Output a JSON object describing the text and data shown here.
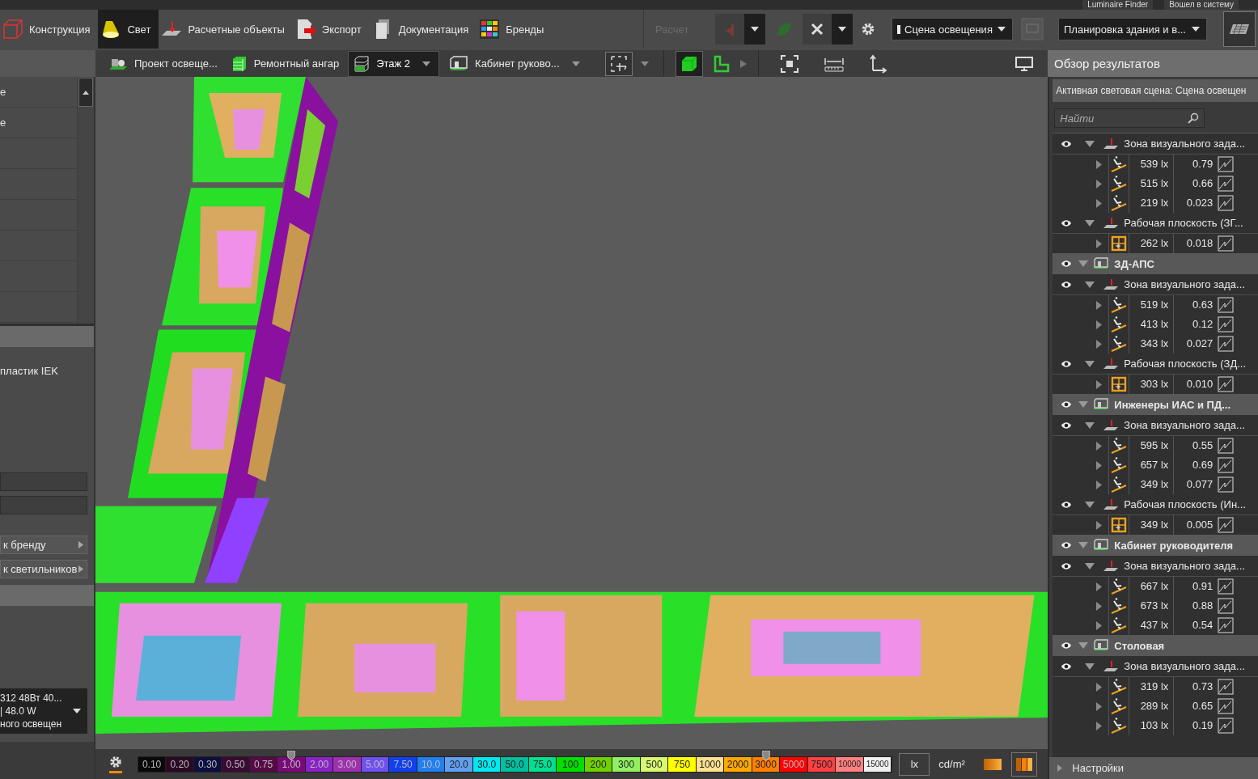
{
  "top_strip": {
    "items": [
      "Luminaire Finder",
      "Вошел в систему"
    ]
  },
  "menu": {
    "tabs": [
      {
        "label": "Конструкция",
        "kind": "construction",
        "selected": false
      },
      {
        "label": "Свет",
        "kind": "light",
        "selected": true
      },
      {
        "label": "Расчетные объекты",
        "kind": "calc",
        "selected": false
      },
      {
        "label": "Экспорт",
        "kind": "export",
        "selected": false
      },
      {
        "label": "Документация",
        "kind": "docs",
        "selected": false
      },
      {
        "label": "Бренды",
        "kind": "brands",
        "selected": false
      }
    ],
    "calc": {
      "label": "Расчет",
      "disabled": true
    },
    "scene": {
      "value": "Сцена освещения"
    },
    "view_mode": {
      "value": "Планировка здания и в..."
    }
  },
  "breadcrumb": [
    {
      "label": "Проект освеще...",
      "kind": "project",
      "selected": false,
      "dropdown": false
    },
    {
      "label": "Ремонтный ангар",
      "kind": "building",
      "selected": false,
      "dropdown": false
    },
    {
      "label": "Этаж 2",
      "kind": "floor",
      "selected": true,
      "dropdown": true
    },
    {
      "label": "Кабинет руково...",
      "kind": "room",
      "selected": false,
      "dropdown": true
    }
  ],
  "view_buttons": [
    {
      "kind": "cube",
      "selected": true
    },
    {
      "kind": "plan",
      "selected": false
    }
  ],
  "left_panel": {
    "list": [
      "е",
      "е"
    ],
    "luminaire_text": "пластик IEK",
    "buttons": [
      "к бренду",
      "к светильников"
    ],
    "luminaire_select": [
      "312 48Вт 40...",
      "| 48.0 W",
      "ного освещен"
    ]
  },
  "legend": {
    "stops": [
      {
        "label": "0.10",
        "color": "#0a0a0a",
        "marked": false
      },
      {
        "label": "0.20",
        "color": "#2a0a22",
        "marked": false
      },
      {
        "label": "0.30",
        "color": "#0e0e40",
        "marked": false
      },
      {
        "label": "0.50",
        "color": "#3a0a34",
        "marked": false
      },
      {
        "label": "0.75",
        "color": "#560a46",
        "marked": false
      },
      {
        "label": "1.00",
        "color": "#7a0a7a",
        "marked": true
      },
      {
        "label": "2.00",
        "color": "#8a22c8",
        "marked": false
      },
      {
        "label": "3.00",
        "color": "#a030b0",
        "marked": false
      },
      {
        "label": "5.00",
        "color": "#7050f0",
        "marked": false
      },
      {
        "label": "7.50",
        "color": "#1040f0",
        "marked": false
      },
      {
        "label": "10.0",
        "color": "#2080f0",
        "marked": false
      },
      {
        "label": "20.0",
        "color": "#60a0f0",
        "marked": false
      },
      {
        "label": "30.0",
        "color": "#00e8f0",
        "marked": false
      },
      {
        "label": "50.0",
        "color": "#00c0a0",
        "marked": false
      },
      {
        "label": "75.0",
        "color": "#00e090",
        "marked": false
      },
      {
        "label": "100",
        "color": "#00e000",
        "marked": false
      },
      {
        "label": "200",
        "color": "#70d000",
        "marked": false
      },
      {
        "label": "300",
        "color": "#90f060",
        "marked": false
      },
      {
        "label": "500",
        "color": "#d8f870",
        "marked": false
      },
      {
        "label": "750",
        "color": "#ffff00",
        "marked": false
      },
      {
        "label": "1000",
        "color": "#ffe090",
        "marked": false
      },
      {
        "label": "2000",
        "color": "#ffa800",
        "marked": false
      },
      {
        "label": "3000",
        "color": "#ff8000",
        "marked": true
      },
      {
        "label": "5000",
        "color": "#ff0000",
        "marked": false
      },
      {
        "label": "7500",
        "color": "#ff4040",
        "marked": false
      },
      {
        "label": "10000",
        "color": "#ff8080",
        "marked": false
      },
      {
        "label": "15000",
        "color": "#f0f0f0",
        "marked": false
      }
    ],
    "units": [
      {
        "label": "lx",
        "selected": true
      },
      {
        "label": "cd/m²",
        "selected": false
      }
    ]
  },
  "results": {
    "title": "Обзор результатов",
    "active_scene": "Активная световая сцена: Сцена освещен",
    "search": {
      "placeholder": "Найти"
    },
    "tree": [
      {
        "kind": "zone",
        "label": "Зона визуального зада...",
        "expanded": true,
        "children": [
          {
            "kind": "point_result",
            "value": "539 lx",
            "ratio": "0.79",
            "expanded": false
          },
          {
            "kind": "point_result",
            "value": "515 lx",
            "ratio": "0.66",
            "expanded": false
          },
          {
            "kind": "point_result",
            "value": "219 lx",
            "ratio": "0.023",
            "expanded": false
          }
        ]
      },
      {
        "kind": "zone",
        "label": "Рабочая плоскость (ЗГ...",
        "expanded": true,
        "children": [
          {
            "kind": "grid_result",
            "value": "262 lx",
            "ratio": "0.018",
            "expanded": false
          }
        ]
      },
      {
        "kind": "room",
        "label": "ЗД-АПС",
        "expanded": true,
        "children": [
          {
            "kind": "zone",
            "label": "Зона визуального зада...",
            "expanded": true,
            "children": [
              {
                "kind": "point_result",
                "value": "519 lx",
                "ratio": "0.63",
                "expanded": false
              },
              {
                "kind": "point_result",
                "value": "413 lx",
                "ratio": "0.12",
                "expanded": false
              },
              {
                "kind": "point_result",
                "value": "343 lx",
                "ratio": "0.027",
                "expanded": false
              }
            ]
          },
          {
            "kind": "zone",
            "label": "Рабочая плоскость (ЗД...",
            "expanded": true,
            "children": [
              {
                "kind": "grid_result",
                "value": "303 lx",
                "ratio": "0.010",
                "expanded": false
              }
            ]
          }
        ]
      },
      {
        "kind": "room",
        "label": "Инженеры ИАС и ПД...",
        "expanded": true,
        "children": [
          {
            "kind": "zone",
            "label": "Зона визуального зада...",
            "expanded": true,
            "children": [
              {
                "kind": "point_result",
                "value": "595 lx",
                "ratio": "0.55",
                "expanded": false
              },
              {
                "kind": "point_result",
                "value": "657 lx",
                "ratio": "0.69",
                "expanded": false
              },
              {
                "kind": "point_result",
                "value": "349 lx",
                "ratio": "0.077",
                "expanded": false
              }
            ]
          },
          {
            "kind": "zone",
            "label": "Рабочая плоскость (Ин...",
            "expanded": true,
            "children": [
              {
                "kind": "grid_result",
                "value": "349 lx",
                "ratio": "0.005",
                "expanded": false
              }
            ]
          }
        ]
      },
      {
        "kind": "room",
        "label": "Кабинет руководителя",
        "expanded": true,
        "children": [
          {
            "kind": "zone",
            "label": "Зона визуального зада...",
            "expanded": true,
            "children": [
              {
                "kind": "point_result",
                "value": "667 lx",
                "ratio": "0.91",
                "expanded": false
              },
              {
                "kind": "point_result",
                "value": "673 lx",
                "ratio": "0.88",
                "expanded": false
              },
              {
                "kind": "point_result",
                "value": "437 lx",
                "ratio": "0.54",
                "expanded": false
              }
            ]
          }
        ]
      },
      {
        "kind": "room",
        "label": "Столовая",
        "expanded": true,
        "children": [
          {
            "kind": "zone",
            "label": "Зона визуального зада...",
            "expanded": true,
            "children": [
              {
                "kind": "point_result",
                "value": "319 lx",
                "ratio": "0.73",
                "expanded": false
              },
              {
                "kind": "point_result",
                "value": "289 lx",
                "ratio": "0.65",
                "expanded": false
              },
              {
                "kind": "point_result",
                "value": "103 lx",
                "ratio": "0.19",
                "expanded": false
              }
            ]
          }
        ]
      }
    ],
    "settings": {
      "label": "Настройки",
      "expanded": false
    }
  }
}
